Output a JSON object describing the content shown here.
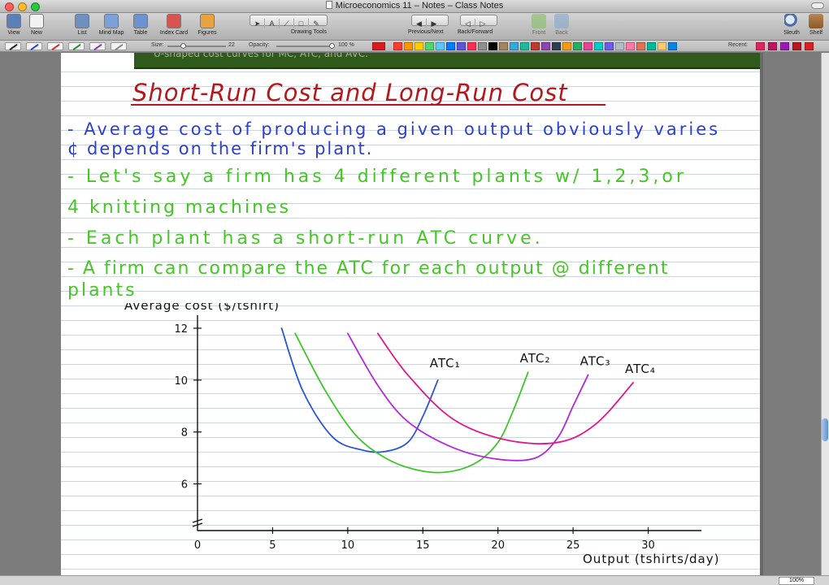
{
  "window": {
    "title": "Microeconomics 11 – Notes – Class Notes",
    "traffic_colors": [
      "#ff5f57",
      "#febc2e",
      "#28c840"
    ]
  },
  "toolbar": {
    "left": [
      {
        "label": "View",
        "icon": "view-icon",
        "color": "#5b7fb8"
      },
      {
        "label": "New",
        "icon": "new-note-icon",
        "color": "#f2f2f2"
      },
      {
        "label": "List",
        "icon": "list-icon",
        "color": "#6d8fc2"
      },
      {
        "label": "Mind Map",
        "icon": "mind-map-icon",
        "color": "#7aa1d9"
      },
      {
        "label": "Table",
        "icon": "table-icon",
        "color": "#6c93cf"
      },
      {
        "label": "Index Card",
        "icon": "index-card-icon",
        "color": "#d9534f"
      },
      {
        "label": "Figures",
        "icon": "figures-icon",
        "color": "#e8a33c"
      }
    ],
    "drawing_tools_label": "Drawing Tools",
    "prevnext_label": "Previous/Next",
    "backforward_label": "Back/Forward",
    "front_label": "Front",
    "back_label": "Back",
    "sleuth_label": "Sleuth",
    "shelf_label": "Shelf"
  },
  "formatbar": {
    "size_label": "Size:",
    "size_value": "22",
    "opacity_label": "Opacity:",
    "opacity_value": "100 %",
    "recent_label": "Recent:",
    "pen_colors": [
      "#222222",
      "#2b3fd0",
      "#d12b2b",
      "#2a8a2a",
      "#7a3db8",
      "#888888"
    ],
    "palette": [
      "#ff3b30",
      "#ff9500",
      "#ffcc00",
      "#4cd964",
      "#5ac8fa",
      "#007aff",
      "#5856d6",
      "#ff2d55",
      "#8e8e93",
      "#000000",
      "#a2845e",
      "#34aadc",
      "#1abc9c",
      "#c0392b",
      "#8e44ad",
      "#2c3e50",
      "#f39c12",
      "#27ae60",
      "#e84393",
      "#00cec9",
      "#6c5ce7",
      "#b2bec3",
      "#fd79a8",
      "#e17055",
      "#00b894",
      "#fdcb6e",
      "#0984e3"
    ],
    "recent_colors": [
      "#e0245e",
      "#c0145e",
      "#9b1bb0",
      "#b3181c",
      "#d92121"
    ]
  },
  "note": {
    "previous_banner": "U-shaped cost curves for MC, ATC, and AVC.",
    "title": "Short-Run Cost and Long-Run Cost",
    "bullets": [
      {
        "color": "blue",
        "lines": [
          "- Average cost of producing a given output obviously varies",
          "  ¢ depends on the firm's plant."
        ]
      },
      {
        "color": "green",
        "lines": [
          "- Let's say a firm has 4 different plants w/ 1,2,3,or",
          "  4 knitting machines"
        ]
      },
      {
        "color": "green",
        "lines": [
          "- Each plant has a short-run ATC curve."
        ]
      },
      {
        "color": "green",
        "lines": [
          "- A firm can compare the ATC for each output @ different",
          "  plants"
        ]
      }
    ]
  },
  "chart_data": {
    "type": "line",
    "ylabel": "Average cost ($/tshirt)",
    "xlabel": "Output (tshirts/day)",
    "x_ticks": [
      0,
      5,
      10,
      15,
      20,
      25,
      30
    ],
    "y_ticks": [
      6,
      8,
      10,
      12
    ],
    "xlim": [
      0,
      33
    ],
    "ylim": [
      4.2,
      12.5
    ],
    "axis_break": true,
    "series": [
      {
        "name": "ATC₁",
        "color": "#2e55d6",
        "x": [
          5.6,
          7.0,
          9.0,
          11.0,
          12.5,
          14.0,
          15.0,
          16.0
        ],
        "y": [
          12.0,
          9.6,
          7.8,
          7.3,
          7.25,
          7.6,
          8.6,
          10.0
        ]
      },
      {
        "name": "ATC₂",
        "color": "#3fc52a",
        "x": [
          6.5,
          8.5,
          10.5,
          12.5,
          14.5,
          16.5,
          18.5,
          20.0,
          21.0,
          22.0
        ],
        "y": [
          11.8,
          9.6,
          7.9,
          7.0,
          6.55,
          6.45,
          6.8,
          7.6,
          8.8,
          10.3
        ]
      },
      {
        "name": "ATC₃",
        "color": "#b22ad6",
        "x": [
          10.0,
          12.0,
          14.0,
          17.0,
          20.0,
          22.5,
          24.0,
          25.0,
          26.0
        ],
        "y": [
          11.8,
          9.8,
          8.4,
          7.4,
          6.95,
          7.0,
          7.8,
          9.0,
          10.2
        ]
      },
      {
        "name": "ATC₄",
        "color": "#e0178f",
        "x": [
          12.0,
          14.0,
          17.0,
          20.5,
          24.0,
          26.5,
          29.0
        ],
        "y": [
          11.8,
          10.2,
          8.5,
          7.7,
          7.6,
          8.3,
          9.9
        ]
      }
    ]
  },
  "status": {
    "zoom": "100%"
  }
}
